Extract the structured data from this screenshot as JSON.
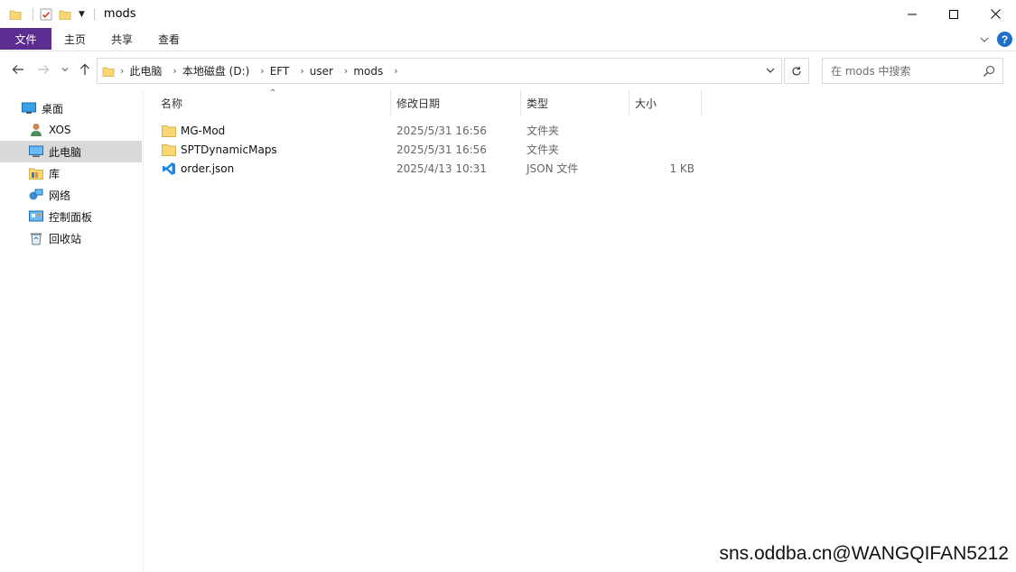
{
  "window": {
    "title": "mods"
  },
  "ribbon": {
    "tabs": [
      "文件",
      "主页",
      "共享",
      "查看"
    ],
    "help_icon_text": "?"
  },
  "address": {
    "crumbs": [
      "此电脑",
      "本地磁盘 (D:)",
      "EFT",
      "user",
      "mods"
    ]
  },
  "search": {
    "placeholder": "在 mods 中搜索"
  },
  "navpane": {
    "items": [
      {
        "label": "桌面",
        "icon": "desktop-icon"
      },
      {
        "label": "XOS",
        "icon": "user-icon"
      },
      {
        "label": "此电脑",
        "icon": "computer-icon",
        "selected": true
      },
      {
        "label": "库",
        "icon": "library-icon"
      },
      {
        "label": "网络",
        "icon": "network-icon"
      },
      {
        "label": "控制面板",
        "icon": "control-panel-icon"
      },
      {
        "label": "回收站",
        "icon": "recycle-bin-icon"
      }
    ]
  },
  "filelist": {
    "columns": [
      "名称",
      "修改日期",
      "类型",
      "大小"
    ],
    "rows": [
      {
        "name": "MG-Mod",
        "date": "2025/5/31 16:56",
        "type": "文件夹",
        "size": "",
        "icon": "folder-icon"
      },
      {
        "name": "SPTDynamicMaps",
        "date": "2025/5/31 16:56",
        "type": "文件夹",
        "size": "",
        "icon": "folder-icon"
      },
      {
        "name": "order.json",
        "date": "2025/4/13 10:31",
        "type": "JSON 文件",
        "size": "1 KB",
        "icon": "vscode-file-icon"
      }
    ]
  },
  "watermark": "sns.oddba.cn@WANGQIFAN5212",
  "colors": {
    "file_tab": "#5c2d91",
    "selection": "#d9d9d9",
    "folder": "#f8d775",
    "accent": "#1e6fcc"
  }
}
